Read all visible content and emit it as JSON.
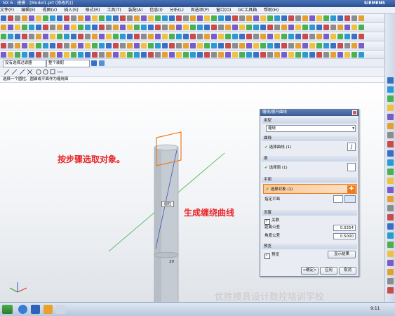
{
  "window": {
    "title": "NX 6 - 建模 - [Model1.prt (修改的)]",
    "brand": "SIEMENS"
  },
  "menubar": {
    "items": [
      "文件(F)",
      "编辑(E)",
      "视图(V)",
      "插入(S)",
      "格式(R)",
      "工具(T)",
      "装配(A)",
      "信息(I)",
      "分析(L)",
      "首选项(P)",
      "窗口(O)",
      "GC工具箱",
      "帮助(H)"
    ]
  },
  "selection_bar": {
    "filter_value": "没有选择过滤器",
    "scope_value": "整个装配"
  },
  "cue_line": "选择一个圆柱、圆锥或平面作为缠绕面",
  "annotations": {
    "step_hint": "按步骤选取对象。",
    "result_hint": "生成缠绕曲线"
  },
  "viewport_labels": {
    "face_label": "圆柱",
    "axis_value": "20"
  },
  "dialog": {
    "title": "缠绕/展开曲线",
    "type_section": "类型",
    "type_value": "缠绕",
    "curve_section": "曲线",
    "curve_value": "选择曲线 (1)",
    "face_section": "面",
    "face_value": "选择面 (1)",
    "plane_section": "平面",
    "plane_value": "选择对象 (1)",
    "plane_option": "指定平面",
    "settings_section": "设置",
    "associative_label": "关联",
    "distance_tol_label": "距离公差",
    "distance_tol_value": "0.0254",
    "angle_tol_label": "角度公差",
    "angle_tol_value": "0.5000",
    "preview_section": "预览",
    "preview_label": "预览",
    "show_result_label": "显示结果",
    "ok_label": "<确定>",
    "apply_label": "应用",
    "cancel_label": "取消"
  },
  "taskbar": {
    "clock": "9:11"
  },
  "watermark": "优胜模具设计数控培训学校",
  "colors": {
    "accent_orange": "#f07a1a",
    "annotation_red": "#e8262a",
    "green_line": "#2fae3e",
    "blue_line": "#3a57b4",
    "titlebar_blue": "#2a4f93"
  }
}
